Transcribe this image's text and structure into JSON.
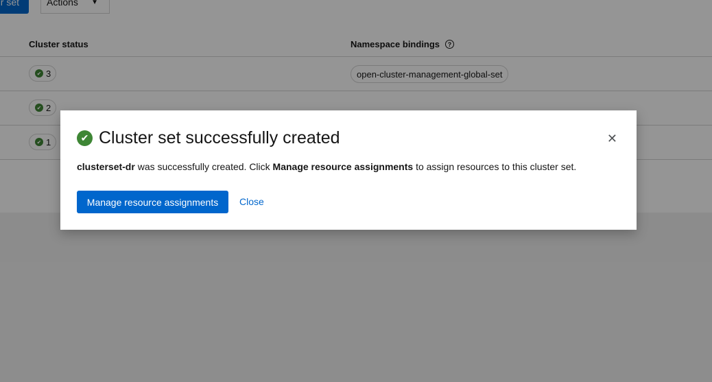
{
  "toolbar": {
    "create_label": "r set",
    "actions_label": "Actions"
  },
  "table": {
    "headers": {
      "cluster_status": "Cluster status",
      "namespace_bindings": "Namespace bindings"
    },
    "rows": [
      {
        "status_count": "3",
        "namespace": "open-cluster-management-global-set"
      },
      {
        "status_count": "2",
        "namespace": ""
      },
      {
        "status_count": "1",
        "namespace": ""
      }
    ]
  },
  "modal": {
    "title": "Cluster set successfully created",
    "body_name": "clusterset-dr",
    "body_text1": "was successfully created. Click",
    "body_link_text": "Manage resource assignments",
    "body_text2": "to assign resources to this cluster set.",
    "primary_button": "Manage resource assignments",
    "close_button": "Close"
  },
  "colors": {
    "primary": "#0066cc",
    "success": "#3e8635",
    "overlay": "rgba(3,3,3,0.42)"
  },
  "icons": {
    "success": "check-circle-icon",
    "close": "times-icon",
    "help": "question-circle-icon",
    "dropdown": "caret-down-icon"
  }
}
